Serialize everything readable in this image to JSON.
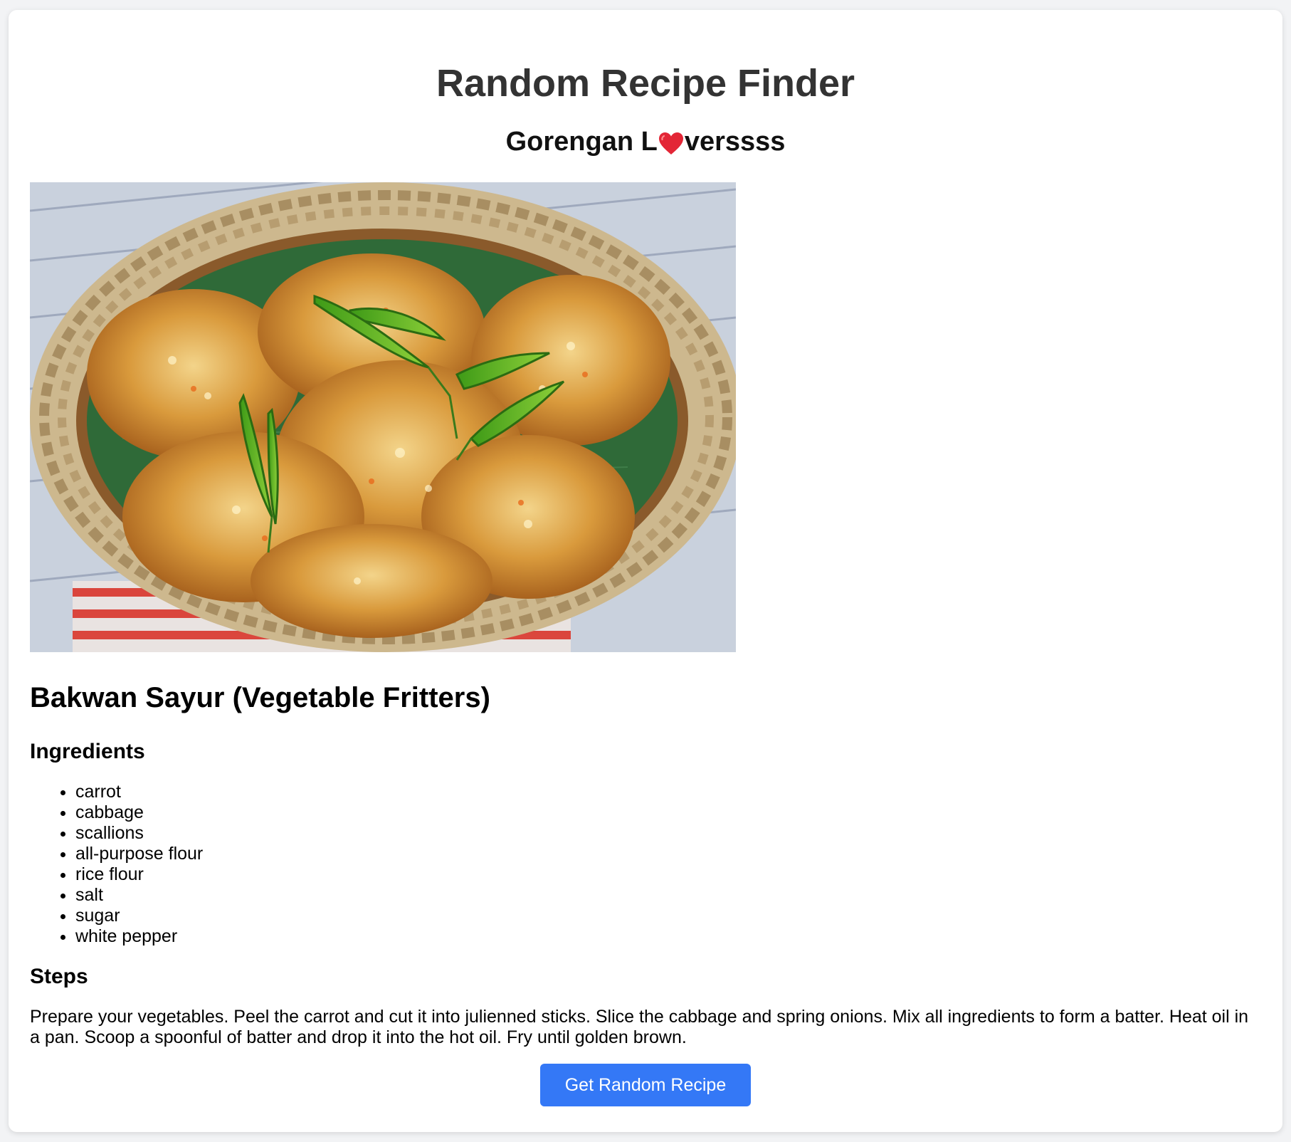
{
  "header": {
    "title": "Random Recipe Finder",
    "subtitle_before": "Gorengan L",
    "subtitle_after": "verssss",
    "heart_icon": "red-heart-emoji"
  },
  "recipe": {
    "image_alt": "Bakwan Sayur (Vegetable Fritters)",
    "name": "Bakwan Sayur (Vegetable Fritters)",
    "ingredients_heading": "Ingredients",
    "ingredients": [
      "carrot",
      "cabbage",
      "scallions",
      "all-purpose flour",
      "rice flour",
      "salt",
      "sugar",
      "white pepper"
    ],
    "steps_heading": "Steps",
    "steps": "Prepare your vegetables. Peel the carrot and cut it into julienned sticks. Slice the cabbage and spring onions. Mix all ingredients to form a batter. Heat oil in a pan. Scoop a spoonful of batter and drop it into the hot oil. Fry until golden brown."
  },
  "actions": {
    "random_button_label": "Get Random Recipe"
  },
  "colors": {
    "button": "#3478f6",
    "title": "#333333",
    "heart": "#e32636"
  }
}
